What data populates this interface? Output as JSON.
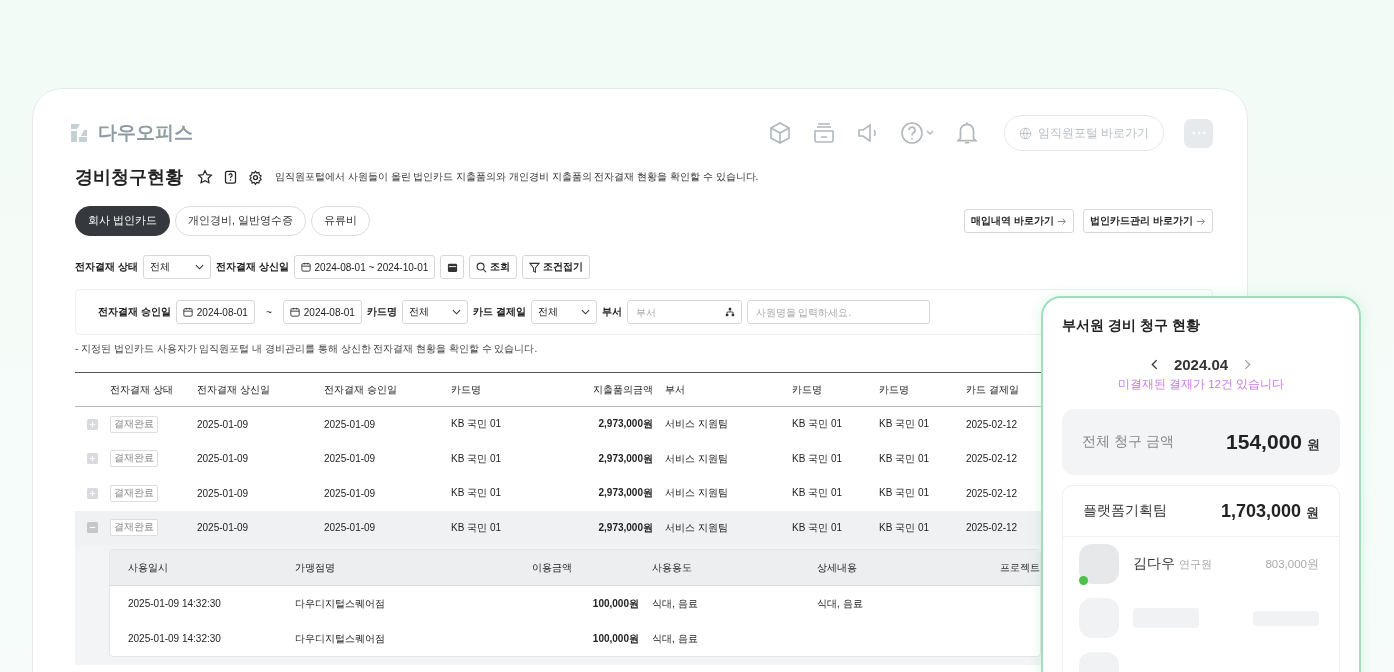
{
  "app": {
    "name": "다우오피스",
    "portal_button": "임직원포털 바로가기"
  },
  "page": {
    "title": "경비청구현황",
    "description": "임직원포털에서 사원들이 올린 법인카드 지출품의와 개인경비 지출품의 전자결재 현황을 확인할 수 있습니다."
  },
  "tabs": [
    {
      "label": "회사 법인카드",
      "selected": true
    },
    {
      "label": "개인경비, 일반영수증",
      "selected": false
    },
    {
      "label": "유류비",
      "selected": false
    }
  ],
  "links": [
    "매입내역 바로가기",
    "법인카드관리 바로가기"
  ],
  "filters": {
    "status_label": "전자결재 상태",
    "status_value": "전체",
    "submit_date_label": "전자결재 상신일",
    "submit_date_range": "2024-08-01 ~ 2024-10-01",
    "search_button": "조회",
    "collapse_button": "조건접기"
  },
  "advanced_filters": {
    "approve_date_label": "전자결재 승인일",
    "approve_from": "2024-08-01",
    "separator": "~",
    "approve_to": "2024-08-01",
    "card_label": "카드명",
    "card_value": "전체",
    "pay_day_label": "카드 결제일",
    "pay_day_value": "전체",
    "dept_label": "부서",
    "dept_placeholder": "부서",
    "employee_placeholder": "사원명을 입력하세요."
  },
  "note": "- 지정된 법인카드 사용자가 임직원포털 내 경비관리를 통해 상신한 전자결재 현황을 확인할 수 있습니다.",
  "table": {
    "columns": [
      "전자결재 상태",
      "전자결재 상신일",
      "전자결재 승인일",
      "카드명",
      "지출품의금액",
      "부서",
      "카드명",
      "카드명",
      "카드 결제일"
    ],
    "rows": [
      {
        "expanded": false,
        "cells": [
          "결재완료",
          "2025-01-09",
          "2025-01-09",
          "KB 국민 01",
          "2,973,000원",
          "서비스 지원팀",
          "KB 국민 01",
          "KB 국민 01",
          "2025-02-12"
        ]
      },
      {
        "expanded": false,
        "cells": [
          "결재완료",
          "2025-01-09",
          "2025-01-09",
          "KB 국민 01",
          "2,973,000원",
          "서비스 지원팀",
          "KB 국민 01",
          "KB 국민 01",
          "2025-02-12"
        ]
      },
      {
        "expanded": false,
        "cells": [
          "결재완료",
          "2025-01-09",
          "2025-01-09",
          "KB 국민 01",
          "2,973,000원",
          "서비스 지원팀",
          "KB 국민 01",
          "KB 국민 01",
          "2025-02-12"
        ]
      },
      {
        "expanded": true,
        "cells": [
          "결재완료",
          "2025-01-09",
          "2025-01-09",
          "KB 국민 01",
          "2,973,000원",
          "서비스 지원팀",
          "KB 국민 01",
          "KB 국민 01",
          "2025-02-12"
        ]
      }
    ]
  },
  "detail_table": {
    "columns": [
      "사용일시",
      "가맹점명",
      "이용금액",
      "사용용도",
      "상세내용",
      "프로젝트"
    ],
    "rows": [
      [
        "2025-01-09 14:32:30",
        "다우디지털스퀘어점",
        "100,000원",
        "식대, 음료",
        "식대, 음료"
      ],
      [
        "2025-01-09 14:32:30",
        "다우디지털스퀘어점",
        "100,000원",
        "식대, 음료"
      ]
    ]
  },
  "panel": {
    "title": "부서원 경비 청구 현황",
    "month": "2024.04",
    "notice": "미결재된 결재가 12건 있습니다",
    "total_label": "전체 청구 금액",
    "total_amount": "154,000",
    "total_unit": "원",
    "team": {
      "name": "플랫폼기획팀",
      "amount": "1,703,000",
      "unit": "원"
    },
    "members": [
      {
        "name": "김다우",
        "rank": "연구원",
        "amount": "803,000원",
        "online": true
      }
    ]
  }
}
